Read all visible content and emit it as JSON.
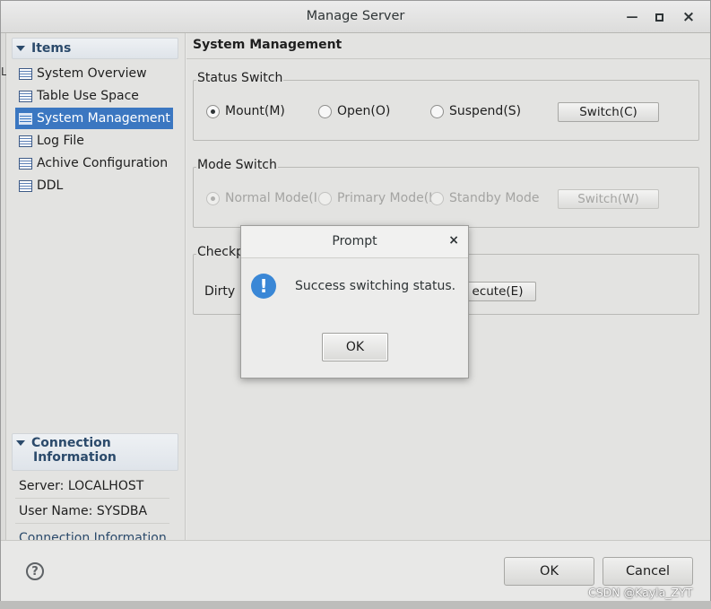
{
  "window": {
    "title": "Manage Server",
    "minimize": "—",
    "maximize": "▪",
    "close": "×"
  },
  "under_left": {
    "mark": "L"
  },
  "sidebar": {
    "items_header": "Items",
    "items": [
      {
        "label": "System Overview"
      },
      {
        "label": "Table Use Space"
      },
      {
        "label": "System Management"
      },
      {
        "label": "Log File"
      },
      {
        "label": "Achive Configuration"
      },
      {
        "label": "DDL"
      }
    ],
    "connection_header_line1": "Connection",
    "connection_header_line2": "Information",
    "server": "Server: LOCALHOST",
    "user_name": "User Name: SYSDBA",
    "partial_item": "Connection Information"
  },
  "main": {
    "title": "System Management",
    "status_switch": {
      "label": "Status Switch",
      "options": [
        "Mount(M)",
        "Open(O)",
        "Suspend(S)"
      ],
      "selected": 0,
      "button": "Switch(C)"
    },
    "mode_switch": {
      "label": "Mode Switch",
      "options": [
        "Normal Mode(I",
        "Primary Mode(I",
        "Standby Mode"
      ],
      "selected": 0,
      "button": "Switch(W)"
    },
    "checkpoint": {
      "label": "Checkpo",
      "row_label": "Dirty P",
      "button": "ecute(E)"
    }
  },
  "footer": {
    "help": "?",
    "ok": "OK",
    "cancel": "Cancel"
  },
  "dialog": {
    "title": "Prompt",
    "close": "×",
    "icon": "!",
    "message": "Success switching status.",
    "ok": "OK"
  },
  "watermark": "CSDN @Kayla_ZYT"
}
